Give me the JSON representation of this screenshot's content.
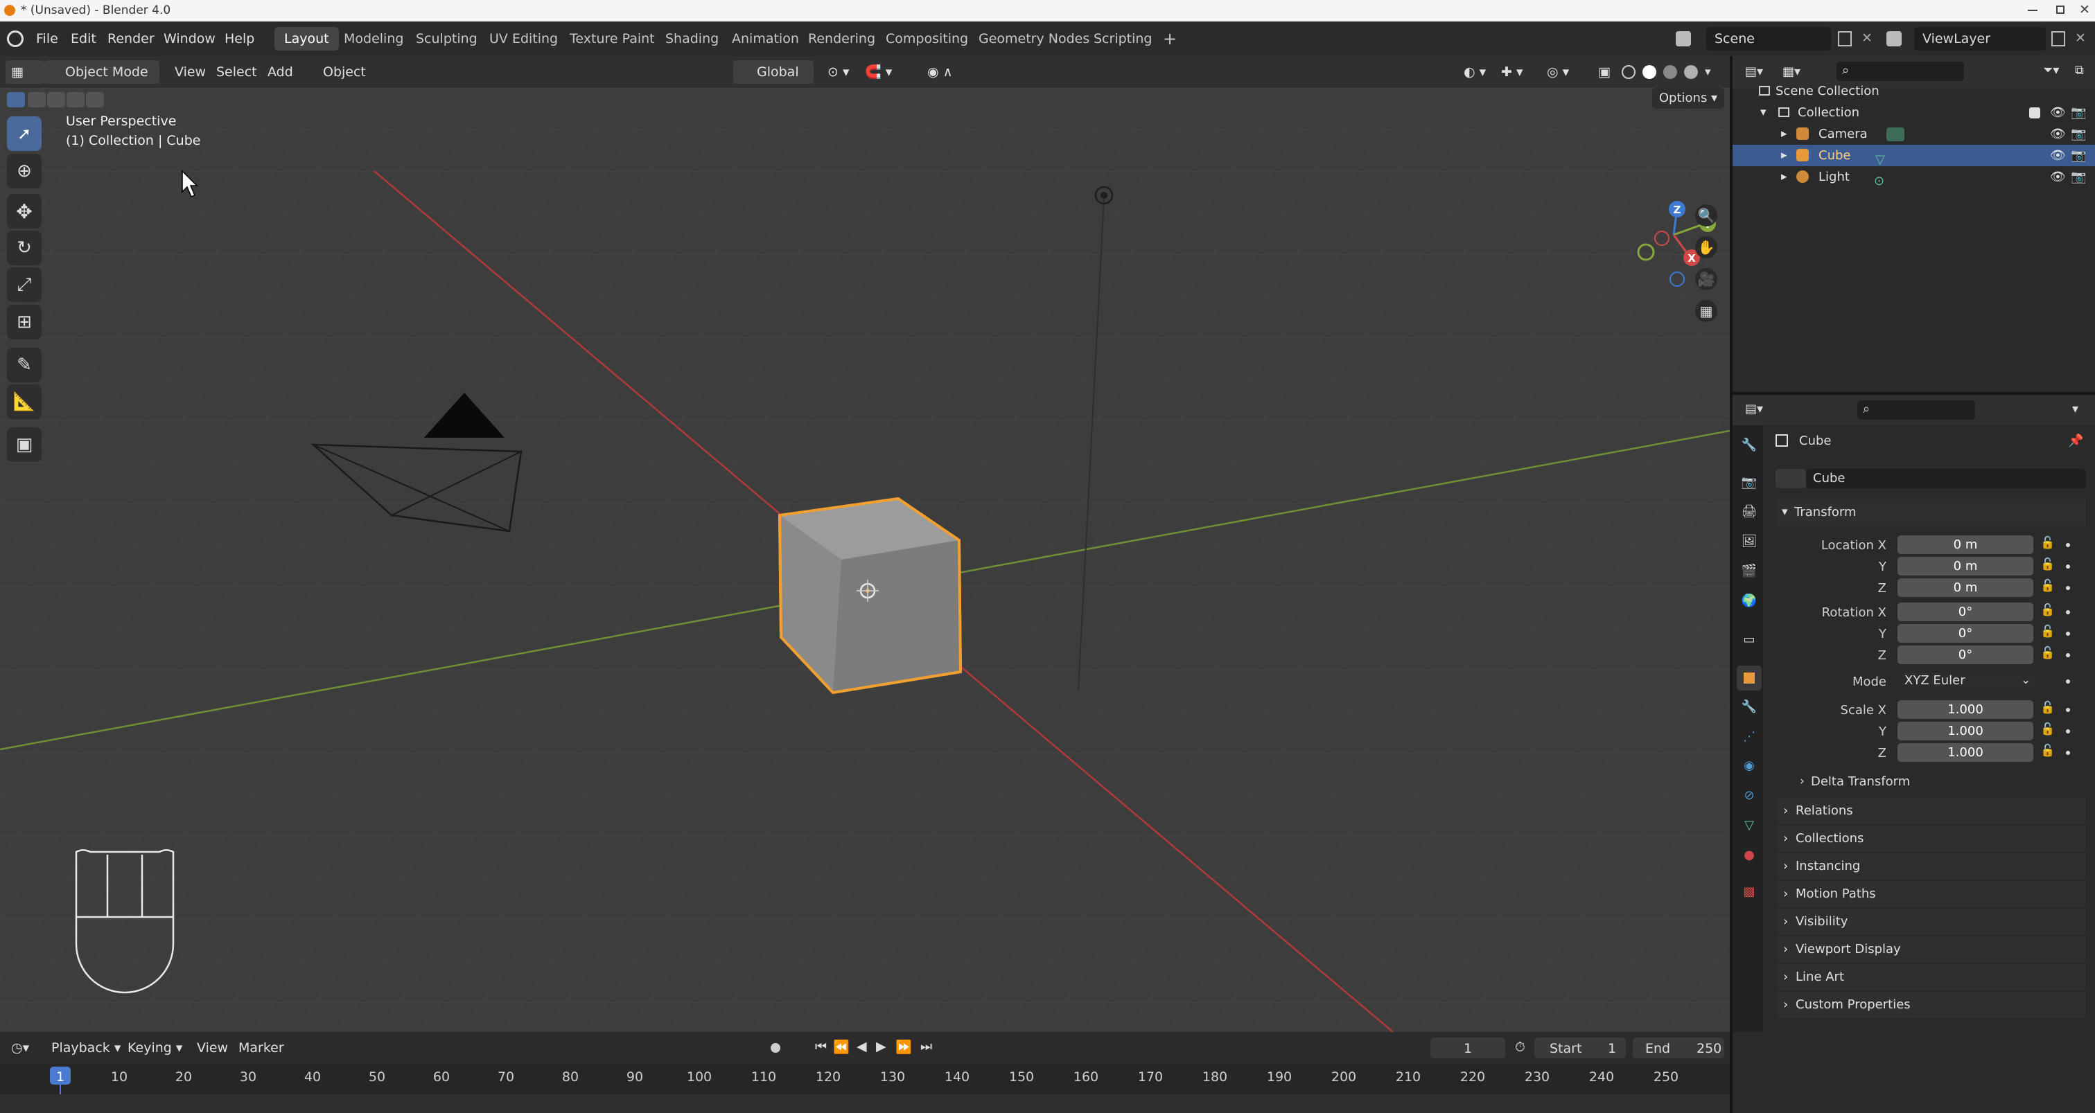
{
  "window": {
    "title": "* (Unsaved) - Blender 4.0",
    "controls": [
      "minimize",
      "maximize",
      "close"
    ]
  },
  "menu": [
    "File",
    "Edit",
    "Render",
    "Window",
    "Help"
  ],
  "workspaces": [
    {
      "label": "Layout",
      "active": true
    },
    {
      "label": "Modeling",
      "active": false
    },
    {
      "label": "Sculpting",
      "active": false
    },
    {
      "label": "UV Editing",
      "active": false
    },
    {
      "label": "Texture Paint",
      "active": false
    },
    {
      "label": "Shading",
      "active": false
    },
    {
      "label": "Animation",
      "active": false
    },
    {
      "label": "Rendering",
      "active": false
    },
    {
      "label": "Compositing",
      "active": false
    },
    {
      "label": "Geometry Nodes",
      "active": false
    },
    {
      "label": "Scripting",
      "active": false
    }
  ],
  "scene": {
    "name": "Scene"
  },
  "view_layer": {
    "name": "ViewLayer"
  },
  "viewport": {
    "mode": "Object Mode",
    "menus": [
      "View",
      "Select",
      "Add",
      "Object"
    ],
    "transform_orientation": "Global",
    "options_label": "Options",
    "overlay_text": {
      "line1": "User Perspective",
      "line2": "(1) Collection | Cube"
    },
    "colors": {
      "x_axis": "#c0392b",
      "y_axis": "#7fa23a",
      "selection": "#f0a030",
      "background": "#3d3d3d"
    }
  },
  "outliner": {
    "root": "Scene Collection",
    "collection": "Collection",
    "items": [
      {
        "name": "Camera",
        "selected": false
      },
      {
        "name": "Cube",
        "selected": true
      },
      {
        "name": "Light",
        "selected": false
      }
    ]
  },
  "properties": {
    "object_name": "Cube",
    "datablock_name": "Cube",
    "transform": {
      "title": "Transform",
      "location": {
        "label": "Location X",
        "x": "0 m",
        "y": "0 m",
        "z": "0 m"
      },
      "rotation": {
        "label": "Rotation X",
        "x": "0°",
        "y": "0°",
        "z": "0°"
      },
      "mode": {
        "label": "Mode",
        "value": "XYZ Euler"
      },
      "scale": {
        "label": "Scale X",
        "x": "1.000",
        "y": "1.000",
        "z": "1.000"
      },
      "axis_labels": {
        "y": "Y",
        "z": "Z"
      }
    },
    "delta_transform": "Delta Transform",
    "panels": [
      "Relations",
      "Collections",
      "Instancing",
      "Motion Paths",
      "Visibility",
      "Viewport Display",
      "Line Art",
      "Custom Properties"
    ]
  },
  "timeline": {
    "menus": [
      "Playback",
      "Keying",
      "View",
      "Marker"
    ],
    "current_frame": "1",
    "start_label": "Start",
    "start_value": "1",
    "end_label": "End",
    "end_value": "250",
    "ruler": [
      "1",
      "10",
      "20",
      "30",
      "40",
      "50",
      "60",
      "70",
      "80",
      "90",
      "100",
      "110",
      "120",
      "130",
      "140",
      "150",
      "160",
      "170",
      "180",
      "190",
      "200",
      "210",
      "220",
      "230",
      "240",
      "250"
    ]
  }
}
